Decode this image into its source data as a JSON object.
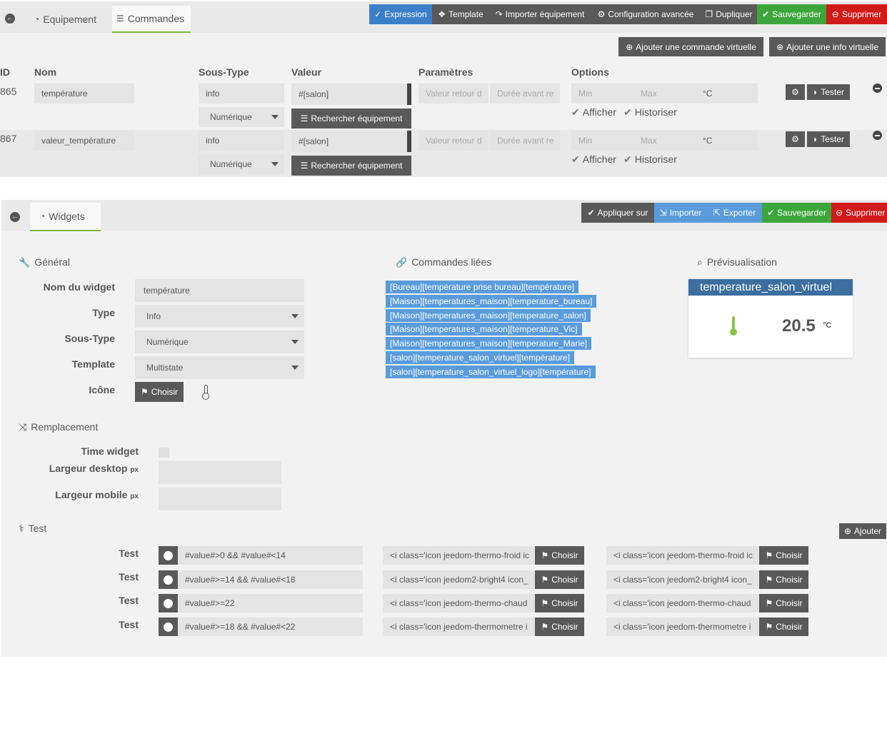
{
  "top_tabs": {
    "equipement": "Equipement",
    "commandes": "Commandes"
  },
  "top_actions": {
    "expression": "Expression",
    "template": "Template",
    "importer": "Importer équipement",
    "config": "Configuration avancée",
    "dupliquer": "Dupliquer",
    "sauvegarder": "Sauvegarder",
    "supprimer": "Supprimer"
  },
  "virtual_buttons": {
    "commande": "Ajouter une commande virtuelle",
    "info": "Ajouter une info virtuelle"
  },
  "table": {
    "headers": {
      "id": "ID",
      "nom": "Nom",
      "soustype": "Sous-Type",
      "valeur": "Valeur",
      "params": "Paramètres",
      "options": "Options"
    },
    "rows": [
      {
        "id": "865",
        "nom": "température",
        "type": "info",
        "subtype": "Numérique",
        "valeur": "#[salon]",
        "rechercher": "Rechercher équipement",
        "retour": "Valeur retour d",
        "duree": "Durée avant re",
        "min": "Min",
        "max": "Max",
        "unit": "°C",
        "afficher": "Afficher",
        "historiser": "Historiser",
        "tester": "Tester"
      },
      {
        "id": "867",
        "nom": "valeur_température",
        "type": "info",
        "subtype": "Numérique",
        "valeur": "#[salon]",
        "rechercher": "Rechercher équipement",
        "retour": "Valeur retour d",
        "duree": "Durée avant re",
        "min": "Min",
        "max": "Max",
        "unit": "°C",
        "afficher": "Afficher",
        "historiser": "Historiser",
        "tester": "Tester"
      }
    ]
  },
  "widgets_tab": "Widgets",
  "widget_actions": {
    "appliquer": "Appliquer sur",
    "importer": "Importer",
    "exporter": "Exporter",
    "sauvegarder": "Sauvegarder",
    "supprimer": "Supprimer"
  },
  "general": {
    "title": "Général",
    "nom_label": "Nom du widget",
    "nom_value": "température",
    "type_label": "Type",
    "type_value": "Info",
    "soustype_label": "Sous-Type",
    "soustype_value": "Numérique",
    "template_label": "Template",
    "template_value": "Multistate",
    "icone_label": "Icône",
    "choisir": "Choisir"
  },
  "linked": {
    "title": "Commandes liées",
    "items": [
      "[Bureau][température prise bureau][température]",
      "[Maison][temperatures_maison][temperature_bureau]",
      "[Maison][temperatures_maison][temperature_salon]",
      "[Maison][temperatures_maison][temperature_Vic]",
      "[Maison][temperatures_maison][temperature_Marie]",
      "[salon][temperature_salon_virtuel][température]",
      "[salon][temperature_salon_virtuel_logo][température]"
    ]
  },
  "preview": {
    "title": "Prévisualisation",
    "widget_name": "temperature_salon_virtuel",
    "value": "20.5",
    "unit": "°C"
  },
  "remplacement": {
    "title": "Remplacement",
    "time_widget": "Time widget",
    "largeur_desktop": "Largeur desktop",
    "largeur_mobile": "Largeur mobile",
    "px": "px"
  },
  "test": {
    "title": "Test",
    "ajouter": "Ajouter",
    "row_label": "Test",
    "choisir": "Choisir",
    "rows": [
      {
        "cond": "#value#>0 && #value#<14",
        "a": "<i class='icon jeedom-thermo-froid ic",
        "b": "<i class='icon jeedom-thermo-froid ic"
      },
      {
        "cond": "#value#>=14 && #value#<18",
        "a": "<i class='icon jeedom2-bright4 icon_",
        "b": "<i class='icon jeedom2-bright4 icon_"
      },
      {
        "cond": "#value#>=22",
        "a": "<i class='icon jeedom-thermo-chaud",
        "b": "<i class='icon jeedom-thermo-chaud"
      },
      {
        "cond": "#value#>=18 && #value#<22",
        "a": "<i class='icon jeedom-thermometre i",
        "b": "<i class='icon jeedom-thermometre i"
      }
    ]
  }
}
